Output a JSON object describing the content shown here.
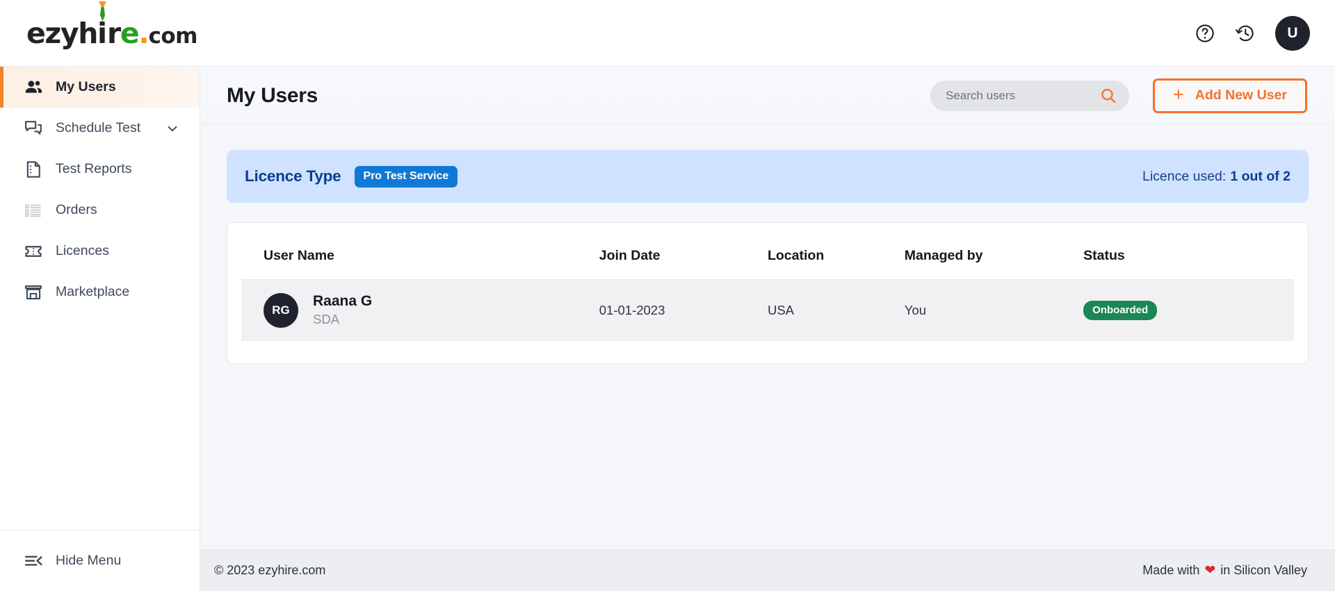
{
  "brand": {
    "logo_part1": "ezyh",
    "logo_i": "i",
    "logo_r": "r",
    "logo_e": "e",
    "logo_dot": ".",
    "logo_com": "com",
    "accent_orange": "#f4712b",
    "accent_green": "#2a9d1f"
  },
  "header": {
    "help_icon": "question-circle-icon",
    "history_icon": "history-icon",
    "avatar_initial": "U"
  },
  "sidebar": {
    "items": [
      {
        "label": "My Users",
        "icon": "people-icon",
        "active": true,
        "has_chevron": false
      },
      {
        "label": "Schedule Test",
        "icon": "chat-icon",
        "active": false,
        "has_chevron": true
      },
      {
        "label": "Test Reports",
        "icon": "document-icon",
        "active": false,
        "has_chevron": false
      },
      {
        "label": "Orders",
        "icon": "list-icon",
        "active": false,
        "has_chevron": false
      },
      {
        "label": "Licences",
        "icon": "ticket-icon",
        "active": false,
        "has_chevron": false
      },
      {
        "label": "Marketplace",
        "icon": "storefront-icon",
        "active": false,
        "has_chevron": false
      }
    ],
    "hide_menu": {
      "label": "Hide Menu",
      "icon": "menu-collapse-icon"
    }
  },
  "page": {
    "title": "My Users"
  },
  "search": {
    "placeholder": "Search users",
    "value": "",
    "icon": "search-icon"
  },
  "add_button": {
    "label": "Add New User",
    "plus": "+"
  },
  "licence": {
    "type_label": "Licence Type",
    "type_badge": "Pro Test Service",
    "used_label": "Licence used:",
    "used_value": "1 out of 2",
    "banner_color": "#cfe2ff",
    "badge_color": "#1179d4"
  },
  "table": {
    "columns": [
      "User Name",
      "Join Date",
      "Location",
      "Managed by",
      "Status"
    ],
    "rows": [
      {
        "initials": "RG",
        "name": "Raana G",
        "role": "SDA",
        "join_date": "01-01-2023",
        "location": "USA",
        "managed_by": "You",
        "status": "Onboarded",
        "status_color": "#1a8754"
      }
    ]
  },
  "footer": {
    "copyright": "© 2023 ezyhire.com",
    "made_with": "Made with",
    "heart": "❤",
    "made_in": "in Silicon Valley"
  }
}
